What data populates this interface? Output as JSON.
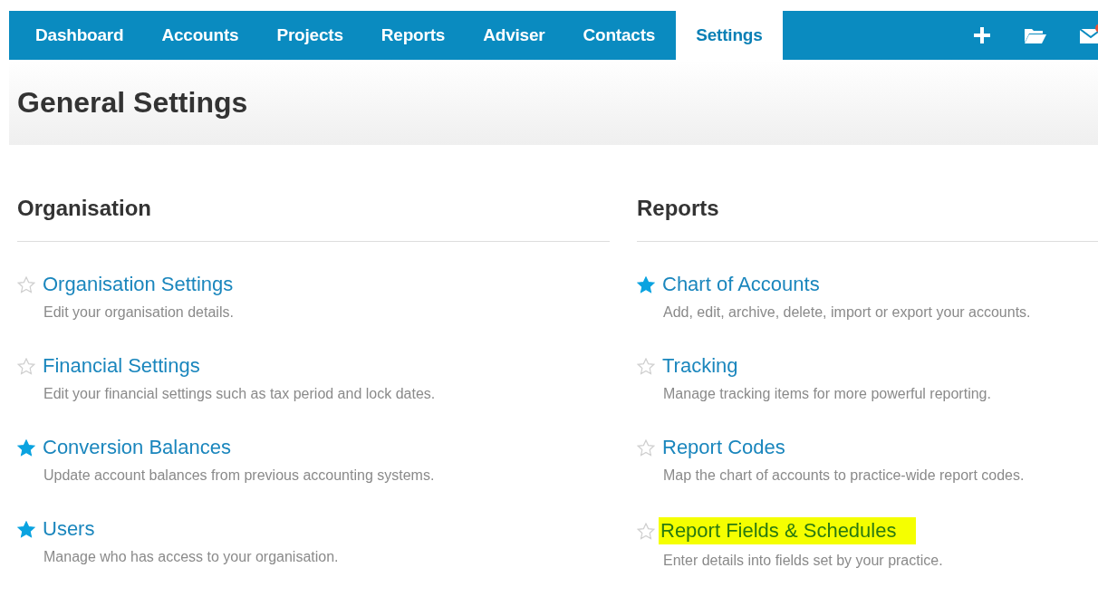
{
  "nav": {
    "tabs": [
      {
        "label": "Dashboard",
        "selected": false
      },
      {
        "label": "Accounts",
        "selected": false
      },
      {
        "label": "Projects",
        "selected": false
      },
      {
        "label": "Reports",
        "selected": false
      },
      {
        "label": "Adviser",
        "selected": false
      },
      {
        "label": "Contacts",
        "selected": false
      },
      {
        "label": "Settings",
        "selected": true
      }
    ],
    "mail_badge": true
  },
  "page_title": "General Settings",
  "sections": [
    {
      "title": "Organisation",
      "items": [
        {
          "label": "Organisation Settings",
          "description": "Edit your organisation details.",
          "starred": false,
          "highlighted": false
        },
        {
          "label": "Financial Settings",
          "description": "Edit your financial settings such as tax period and lock dates.",
          "starred": false,
          "highlighted": false
        },
        {
          "label": "Conversion Balances",
          "description": "Update account balances from previous accounting systems.",
          "starred": true,
          "highlighted": false
        },
        {
          "label": "Users",
          "description": "Manage who has access to your organisation.",
          "starred": true,
          "highlighted": false
        }
      ]
    },
    {
      "title": "Reports",
      "items": [
        {
          "label": "Chart of Accounts",
          "description": "Add, edit, archive, delete, import or export your accounts.",
          "starred": true,
          "highlighted": false
        },
        {
          "label": "Tracking",
          "description": "Manage tracking items for more powerful reporting.",
          "starred": false,
          "highlighted": false
        },
        {
          "label": "Report Codes",
          "description": "Map the chart of accounts to practice-wide report codes.",
          "starred": false,
          "highlighted": false
        },
        {
          "label": "Report Fields & Schedules",
          "description": "Enter details into fields set by your practice.",
          "starred": false,
          "highlighted": true
        }
      ]
    }
  ]
}
